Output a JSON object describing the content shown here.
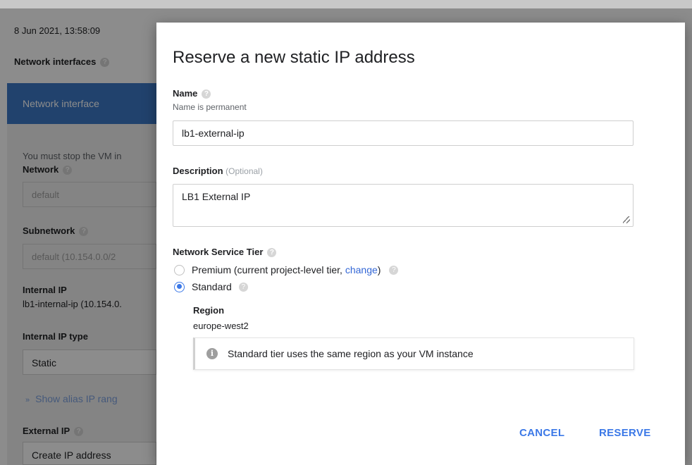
{
  "background": {
    "timestamp": "8 Jun 2021, 13:58:09",
    "network_interfaces_label": "Network interfaces",
    "network_interface_header": "Network interface",
    "stop_vm_text": "You must stop the VM in",
    "network_label": "Network",
    "network_value": "default",
    "subnetwork_label": "Subnetwork",
    "subnetwork_value": "default (10.154.0.0/2",
    "internal_ip_label": "Internal IP",
    "internal_ip_value": "lb1-internal-ip (10.154.0.",
    "internal_ip_type_label": "Internal IP type",
    "internal_ip_type_value": "Static",
    "show_alias_link": "Show alias IP rang",
    "external_ip_label": "External IP",
    "external_ip_value": "Create IP address"
  },
  "dialog": {
    "title": "Reserve a new static IP address",
    "name_label": "Name",
    "name_hint": "Name is permanent",
    "name_value": "lb1-external-ip",
    "description_label": "Description",
    "description_optional": "(Optional)",
    "description_value": "LB1 External IP",
    "tier_label": "Network Service Tier",
    "premium_text": "Premium (current project-level tier,",
    "premium_change_link": "change",
    "premium_close": ")",
    "premium_selected": false,
    "standard_text": "Standard",
    "standard_selected": true,
    "region_label": "Region",
    "region_value": "europe-west2",
    "info_text": "Standard tier uses the same region as your VM instance",
    "cancel_label": "CANCEL",
    "reserve_label": "RESERVE"
  },
  "colors": {
    "accent": "#3b78e7",
    "link": "#3367d6",
    "header_blue": "#3d78c6"
  },
  "icons": {
    "help": "help-icon",
    "info": "info-icon",
    "chevron": "chevron-double-down-icon"
  }
}
